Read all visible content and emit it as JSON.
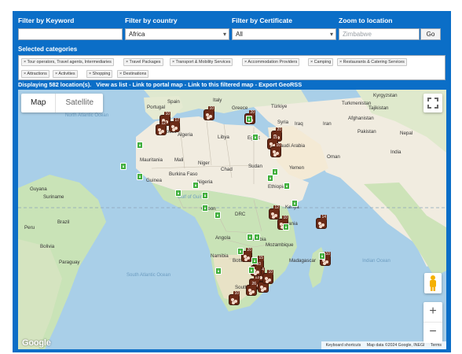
{
  "filters": {
    "keyword_label": "Filter by Keyword",
    "keyword_value": "",
    "country_label": "Filter by country",
    "country_value": "Africa",
    "certificate_label": "Filter by Certificate",
    "certificate_value": "All",
    "zoom_label": "Zoom to location",
    "zoom_placeholder": "Zimbabwe",
    "go_label": "Go"
  },
  "categories": {
    "label": "Selected categories",
    "chips": [
      "× Tour operators, Travel agents, Intermediaries",
      "× Travel Packages",
      "× Transport & Mobility Services",
      "× Accommodation Providers",
      "× Camping",
      "× Restaurants & Catering Services",
      "× Attractions",
      "× Activities",
      "× Shopping",
      "× Destinations"
    ]
  },
  "status": {
    "displaying": "Displaying 582 location(s).",
    "links": "View as list - Link to portal map - Link to this filtered map - Export GeoRSS"
  },
  "map": {
    "map_type": "Map",
    "satellite": "Satellite",
    "google": "Google",
    "attribution": [
      "Keyboard shortcuts",
      "Map data ©2024 Google, INEGI",
      "Terms"
    ],
    "zoom_in": "+",
    "zoom_out": "−",
    "labels": {
      "portugal": "Portugal",
      "spain": "Spain",
      "italy": "Italy",
      "greece": "Greece",
      "turkey": "Türkiye",
      "kyrgyzstan": "Kyrgyzstan",
      "turkmenistan": "Turkmenistan",
      "tajikistan": "Tajikistan",
      "syria": "Syria",
      "iraq": "Iraq",
      "iran": "Iran",
      "afghanistan": "Afghanistan",
      "pakistan": "Pakistan",
      "india": "India",
      "nepal": "Nepal",
      "morocco": "Morocco",
      "algeria": "Algeria",
      "libya": "Libya",
      "egypt": "Egypt",
      "saudi": "Saudi Arabia",
      "oman": "Oman",
      "yemen": "Yemen",
      "mauritania": "Mauritania",
      "mali": "Mali",
      "niger": "Niger",
      "chad": "Chad",
      "sudan": "Sudan",
      "burkina": "Burkina Faso",
      "guinea": "Guinea",
      "nigeria": "Nigeria",
      "ethiopia": "Ethiopia",
      "gulf_guinea": "Gulf of Guinea",
      "guyana": "Guyana",
      "suriname": "Suriname",
      "gabon": "Gabon",
      "drc": "DRC",
      "kenya": "Kenya",
      "tanzania": "Tanzania",
      "angola": "Angola",
      "zambia": "Zambia",
      "mozambique": "Mozambique",
      "namibia": "Namibia",
      "botswana": "Botswana",
      "madagascar": "Madagascar",
      "south_africa": "South Afri",
      "peru": "Peru",
      "brazil": "Brazil",
      "bolivia": "Bolivia",
      "paraguay": "Paraguay",
      "north_atlantic": "North Atlantic Ocean",
      "south_atlantic": "South Atlantic Ocean",
      "indian": "Indian Ocean"
    },
    "cluster_counts": [
      "10",
      "10",
      "17",
      "12",
      "20",
      "20",
      "15",
      "10",
      "12",
      "10",
      "14",
      "10",
      "20",
      "15",
      "14",
      "13",
      "10",
      "26",
      "37",
      "10",
      "10"
    ]
  },
  "colors": {
    "panel": "#0b6ec7",
    "ocean": "#a9cfe8",
    "land_desert": "#f1ece0",
    "land_green": "#c9e3b7",
    "cluster": "#6b2b17",
    "pin": "#3fae3b"
  }
}
